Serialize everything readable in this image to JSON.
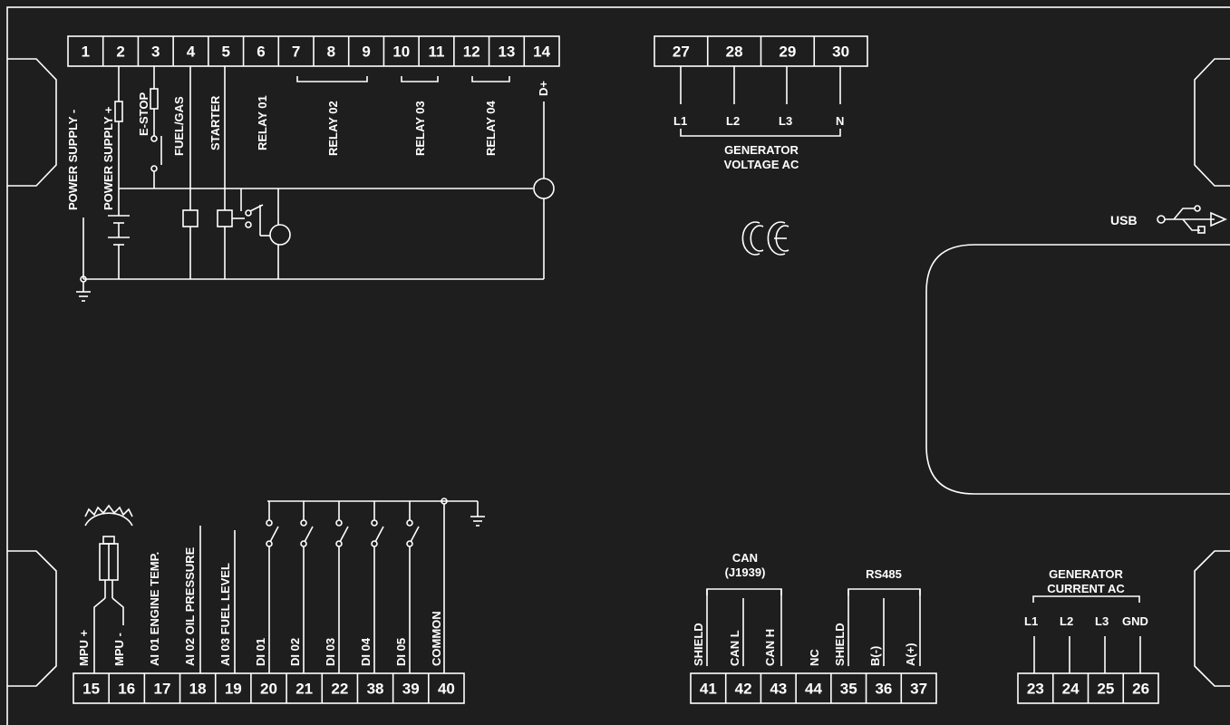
{
  "terminals": {
    "top_left": [
      "1",
      "2",
      "3",
      "4",
      "5",
      "6",
      "7",
      "8",
      "9",
      "10",
      "11",
      "12",
      "13",
      "14"
    ],
    "generator_voltage": [
      "27",
      "28",
      "29",
      "30"
    ],
    "bottom_left": [
      "15",
      "16",
      "17",
      "18",
      "19",
      "20",
      "21",
      "22",
      "38",
      "39",
      "40"
    ],
    "can_rs485": [
      "41",
      "42",
      "43",
      "44",
      "35",
      "36",
      "37"
    ],
    "generator_current": [
      "23",
      "24",
      "25",
      "26"
    ]
  },
  "labels": {
    "power_supply_minus": "POWER SUPPLY -",
    "power_supply_plus": "POWER SUPPLY +",
    "e_stop": "E-STOP",
    "fuel_gas": "FUEL/GAS",
    "starter": "STARTER",
    "relay01": "RELAY 01",
    "relay02": "RELAY 02",
    "relay03": "RELAY 03",
    "relay04": "RELAY 04",
    "d_plus": "D+",
    "mpu_plus": "MPU +",
    "mpu_minus": "MPU -",
    "ai01": "AI 01 ENGINE TEMP.",
    "ai02": "AI 02 OIL PRESSURE",
    "ai03": "AI 03 FUEL LEVEL",
    "di01": "DI 01",
    "di02": "DI 02",
    "di03": "DI 03",
    "di04": "DI 04",
    "di05": "DI 05",
    "common": "COMMON"
  },
  "generator_voltage": {
    "l1": "L1",
    "l2": "L2",
    "l3": "L3",
    "n": "N",
    "title_line1": "GENERATOR",
    "title_line2": "VOLTAGE AC"
  },
  "usb": {
    "label": "USB"
  },
  "can": {
    "title": "CAN",
    "subtitle": "(J1939)",
    "shield": "SHIELD",
    "can_l": "CAN L",
    "can_h": "CAN H",
    "nc": "NC"
  },
  "rs485": {
    "title": "RS485",
    "shield": "SHIELD",
    "b_minus": "B(-)",
    "a_plus": "A(+)"
  },
  "generator_current": {
    "title_line1": "GENERATOR",
    "title_line2": "CURRENT AC",
    "l1": "L1",
    "l2": "L2",
    "l3": "L3",
    "gnd": "GND"
  }
}
